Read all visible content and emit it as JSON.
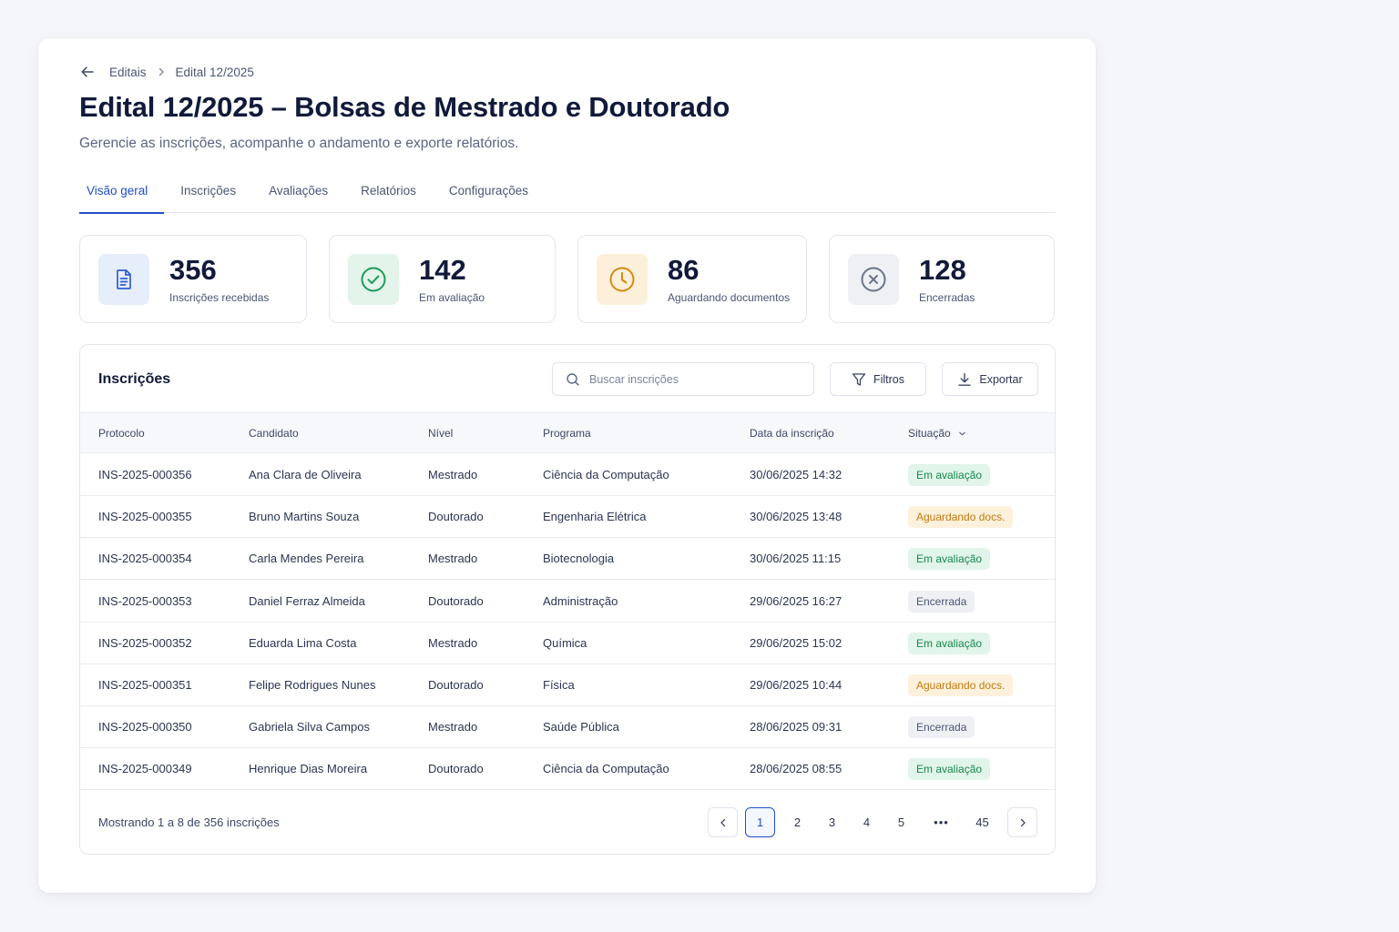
{
  "breadcrumb": {
    "parent": "Editais",
    "current": "Edital 12/2025"
  },
  "page": {
    "title": "Edital 12/2025 – Bolsas de Mestrado e Doutorado",
    "subtitle": "Gerencie as inscrições, acompanhe o andamento e exporte relatórios."
  },
  "tabs": [
    "Visão geral",
    "Inscrições",
    "Avaliações",
    "Relatórios",
    "Configurações"
  ],
  "active_tab": "Visão geral",
  "stats": [
    {
      "value": "356",
      "label": "Inscrições recebidas",
      "icon": "document-icon",
      "bg": "#e6edfb",
      "fg": "#2f5fcf"
    },
    {
      "value": "142",
      "label": "Em avaliação",
      "icon": "check-circle-icon",
      "bg": "#e3f4ea",
      "fg": "#1f9a5a"
    },
    {
      "value": "86",
      "label": "Aguardando documentos",
      "icon": "clock-icon",
      "bg": "#fdf0da",
      "fg": "#d48a13"
    },
    {
      "value": "128",
      "label": "Encerradas",
      "icon": "x-circle-icon",
      "bg": "#eef0f4",
      "fg": "#6b7489"
    }
  ],
  "table": {
    "title": "Inscrições",
    "search_placeholder": "Buscar inscrições",
    "filters_label": "Filtros",
    "export_label": "Exportar",
    "columns": [
      "Protocolo",
      "Candidato",
      "Nível",
      "Programa",
      "Data da inscrição",
      "Situação"
    ],
    "rows": [
      {
        "protocolo": "INS-2025-000356",
        "candidato": "Ana Clara de Oliveira",
        "nivel": "Mestrado",
        "programa": "Ciência da Computação",
        "data": "30/06/2025 14:32",
        "situacao": "Em avaliação",
        "status": "green"
      },
      {
        "protocolo": "INS-2025-000355",
        "candidato": "Bruno Martins Souza",
        "nivel": "Doutorado",
        "programa": "Engenharia Elétrica",
        "data": "30/06/2025 13:48",
        "situacao": "Aguardando docs.",
        "status": "amber"
      },
      {
        "protocolo": "INS-2025-000354",
        "candidato": "Carla Mendes Pereira",
        "nivel": "Mestrado",
        "programa": "Biotecnologia",
        "data": "30/06/2025 11:15",
        "situacao": "Em avaliação",
        "status": "green"
      },
      {
        "protocolo": "INS-2025-000353",
        "candidato": "Daniel Ferraz Almeida",
        "nivel": "Doutorado",
        "programa": "Administração",
        "data": "29/06/2025 16:27",
        "situacao": "Encerrada",
        "status": "gray"
      },
      {
        "protocolo": "INS-2025-000352",
        "candidato": "Eduarda Lima Costa",
        "nivel": "Mestrado",
        "programa": "Química",
        "data": "29/06/2025 15:02",
        "situacao": "Em avaliação",
        "status": "green"
      },
      {
        "protocolo": "INS-2025-000351",
        "candidato": "Felipe Rodrigues Nunes",
        "nivel": "Doutorado",
        "programa": "Física",
        "data": "29/06/2025 10:44",
        "situacao": "Aguardando docs.",
        "status": "amber"
      },
      {
        "protocolo": "INS-2025-000350",
        "candidato": "Gabriela Silva Campos",
        "nivel": "Mestrado",
        "programa": "Saúde Pública",
        "data": "28/06/2025 09:31",
        "situacao": "Encerrada",
        "status": "gray"
      },
      {
        "protocolo": "INS-2025-000349",
        "candidato": "Henrique Dias Moreira",
        "nivel": "Doutorado",
        "programa": "Ciência da Computação",
        "data": "28/06/2025 08:55",
        "situacao": "Em avaliação",
        "status": "green"
      }
    ],
    "footer_text": "Mostrando 1 a 8 de 356 inscrições"
  },
  "pagination": {
    "pages": [
      "1",
      "2",
      "3",
      "4",
      "5",
      "•••",
      "45"
    ],
    "current": "1"
  },
  "status_colors": {
    "green": {
      "bg": "#e1f5ea",
      "fg": "#17874c"
    },
    "amber": {
      "bg": "#fdf1dc",
      "fg": "#c27a0c"
    },
    "gray": {
      "bg": "#eef0f4",
      "fg": "#4b5675"
    }
  },
  "accent": "#1e4fc6"
}
